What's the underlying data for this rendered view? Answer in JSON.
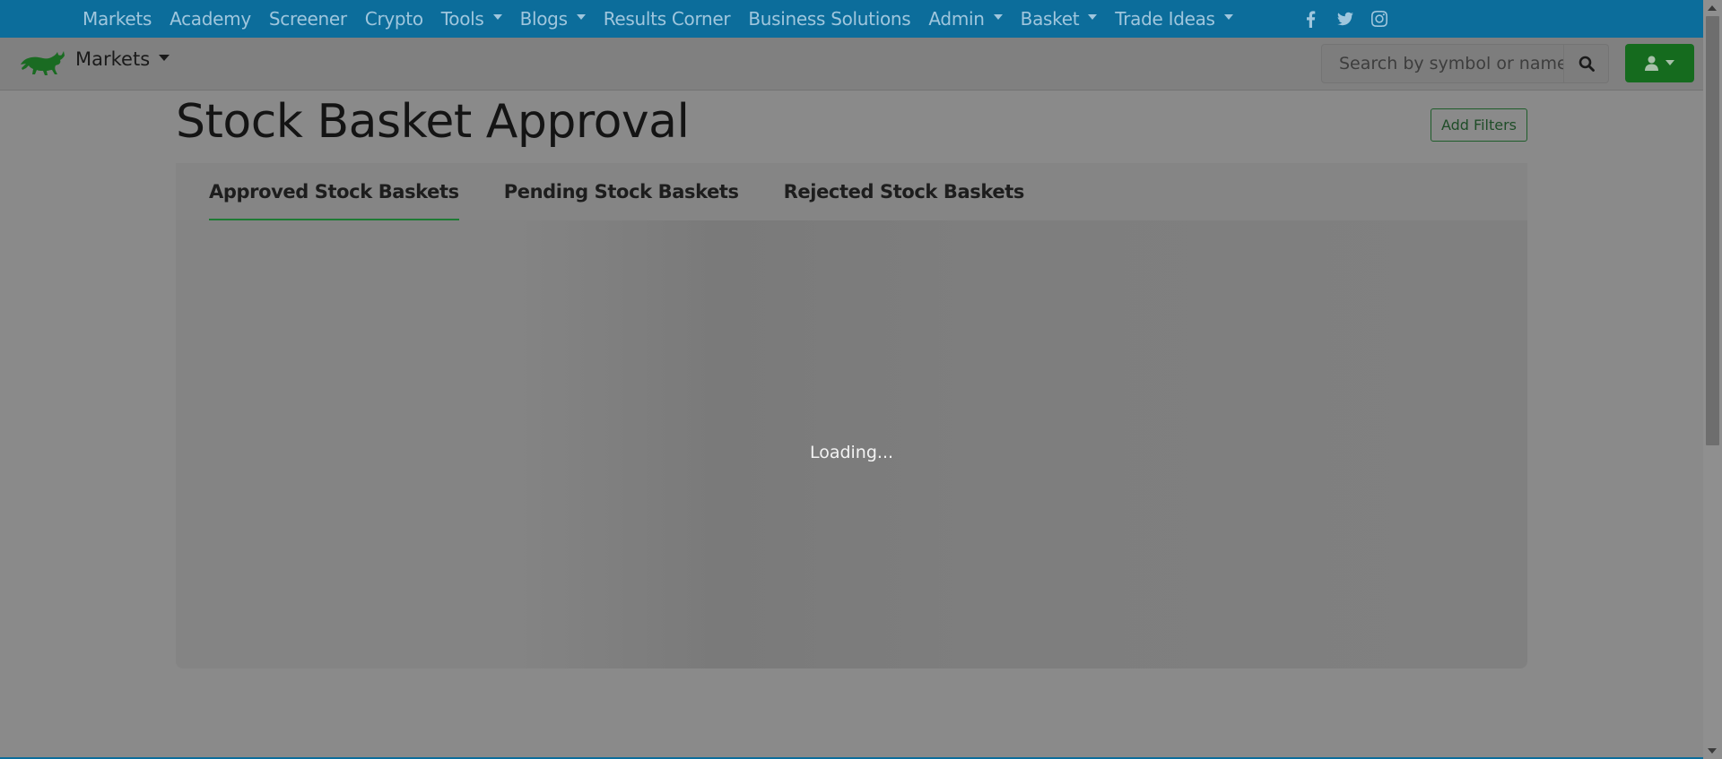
{
  "topnav": {
    "items": [
      {
        "label": "Markets",
        "dropdown": false
      },
      {
        "label": "Academy",
        "dropdown": false
      },
      {
        "label": "Screener",
        "dropdown": false
      },
      {
        "label": "Crypto",
        "dropdown": false
      },
      {
        "label": "Tools",
        "dropdown": true
      },
      {
        "label": "Blogs",
        "dropdown": true
      },
      {
        "label": "Results Corner",
        "dropdown": false
      },
      {
        "label": "Business Solutions",
        "dropdown": false
      },
      {
        "label": "Admin",
        "dropdown": true
      },
      {
        "label": "Basket",
        "dropdown": true
      },
      {
        "label": "Trade Ideas",
        "dropdown": true
      }
    ],
    "socials": [
      "facebook-icon",
      "twitter-icon",
      "instagram-icon"
    ],
    "background": "#0c6d9b"
  },
  "subnav": {
    "markets_label": "Markets",
    "search_placeholder": "Search by symbol or name",
    "user_button_color": "#156b1e"
  },
  "page": {
    "title": "Stock Basket Approval",
    "add_filters_label": "Add Filters",
    "tabs": [
      {
        "label": "Approved Stock Baskets",
        "active": true
      },
      {
        "label": "Pending Stock Baskets",
        "active": false
      },
      {
        "label": "Rejected Stock Baskets",
        "active": false
      }
    ],
    "loading_text": "Loading..."
  }
}
